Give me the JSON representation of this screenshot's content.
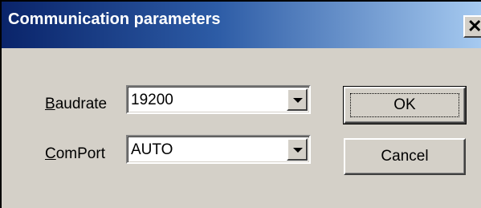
{
  "window": {
    "title": "Communication parameters",
    "close_glyph": "✕"
  },
  "form": {
    "baudrate": {
      "label_accel": "B",
      "label_rest": "audrate",
      "value": "19200"
    },
    "comport": {
      "label_accel": "C",
      "label_rest": "omPort",
      "value": "AUTO"
    }
  },
  "buttons": {
    "ok_label": "OK",
    "cancel_label": "Cancel"
  },
  "colors": {
    "face": "#d4d0c8",
    "title_start": "#0a246a",
    "title_end": "#a6caf0"
  },
  "icons": {
    "close": "close-icon",
    "dropdown": "chevron-down-icon"
  }
}
